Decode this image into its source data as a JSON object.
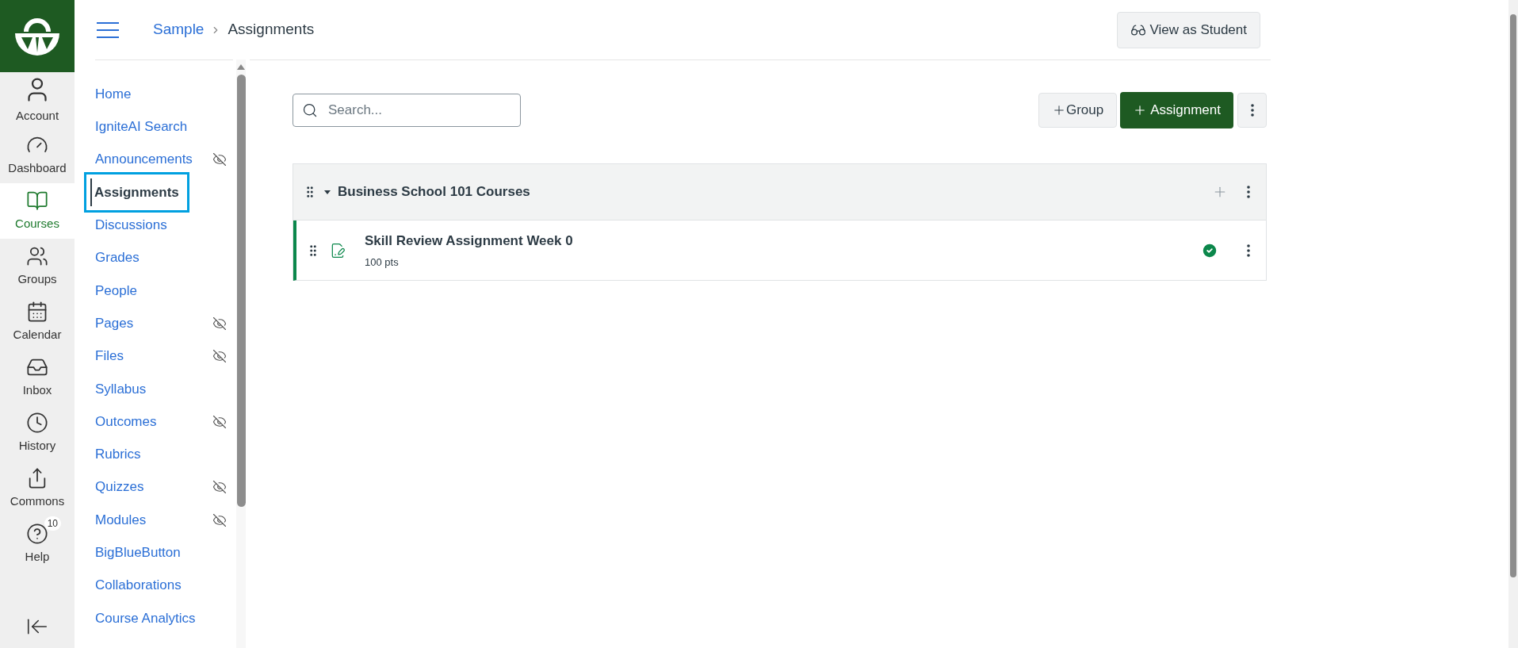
{
  "global_nav": [
    {
      "label": "Account",
      "selected": false
    },
    {
      "label": "Dashboard",
      "selected": false
    },
    {
      "label": "Courses",
      "selected": true
    },
    {
      "label": "Groups",
      "selected": false
    },
    {
      "label": "Calendar",
      "selected": false
    },
    {
      "label": "Inbox",
      "selected": false
    },
    {
      "label": "History",
      "selected": false
    },
    {
      "label": "Commons",
      "selected": false
    },
    {
      "label": "Help",
      "selected": false,
      "badge": "10"
    }
  ],
  "breadcrumb": [
    {
      "label": "Sample"
    },
    {
      "label": "Assignments"
    }
  ],
  "view_as_student": "View as Student",
  "course_nav": [
    {
      "label": "Home",
      "selected": false,
      "hidden": false
    },
    {
      "label": "IgniteAI Search",
      "selected": false,
      "hidden": false
    },
    {
      "label": "Announcements",
      "selected": false,
      "hidden": true
    },
    {
      "label": "Assignments",
      "selected": true,
      "hidden": false
    },
    {
      "label": "Discussions",
      "selected": false,
      "hidden": false
    },
    {
      "label": "Grades",
      "selected": false,
      "hidden": false
    },
    {
      "label": "People",
      "selected": false,
      "hidden": false
    },
    {
      "label": "Pages",
      "selected": false,
      "hidden": true
    },
    {
      "label": "Files",
      "selected": false,
      "hidden": true
    },
    {
      "label": "Syllabus",
      "selected": false,
      "hidden": false
    },
    {
      "label": "Outcomes",
      "selected": false,
      "hidden": true
    },
    {
      "label": "Rubrics",
      "selected": false,
      "hidden": false
    },
    {
      "label": "Quizzes",
      "selected": false,
      "hidden": true
    },
    {
      "label": "Modules",
      "selected": false,
      "hidden": true
    },
    {
      "label": "BigBlueButton",
      "selected": false,
      "hidden": false
    },
    {
      "label": "Collaborations",
      "selected": false,
      "hidden": false
    },
    {
      "label": "Course Analytics",
      "selected": false,
      "hidden": false
    }
  ],
  "search": {
    "placeholder": "Search..."
  },
  "buttons": {
    "group": "Group",
    "assignment": "Assignment"
  },
  "groups": [
    {
      "title": "Business School 101 Courses",
      "expanded": true,
      "items": [
        {
          "title": "Skill Review Assignment Week 0",
          "points": "100 pts",
          "published": true
        }
      ]
    }
  ]
}
